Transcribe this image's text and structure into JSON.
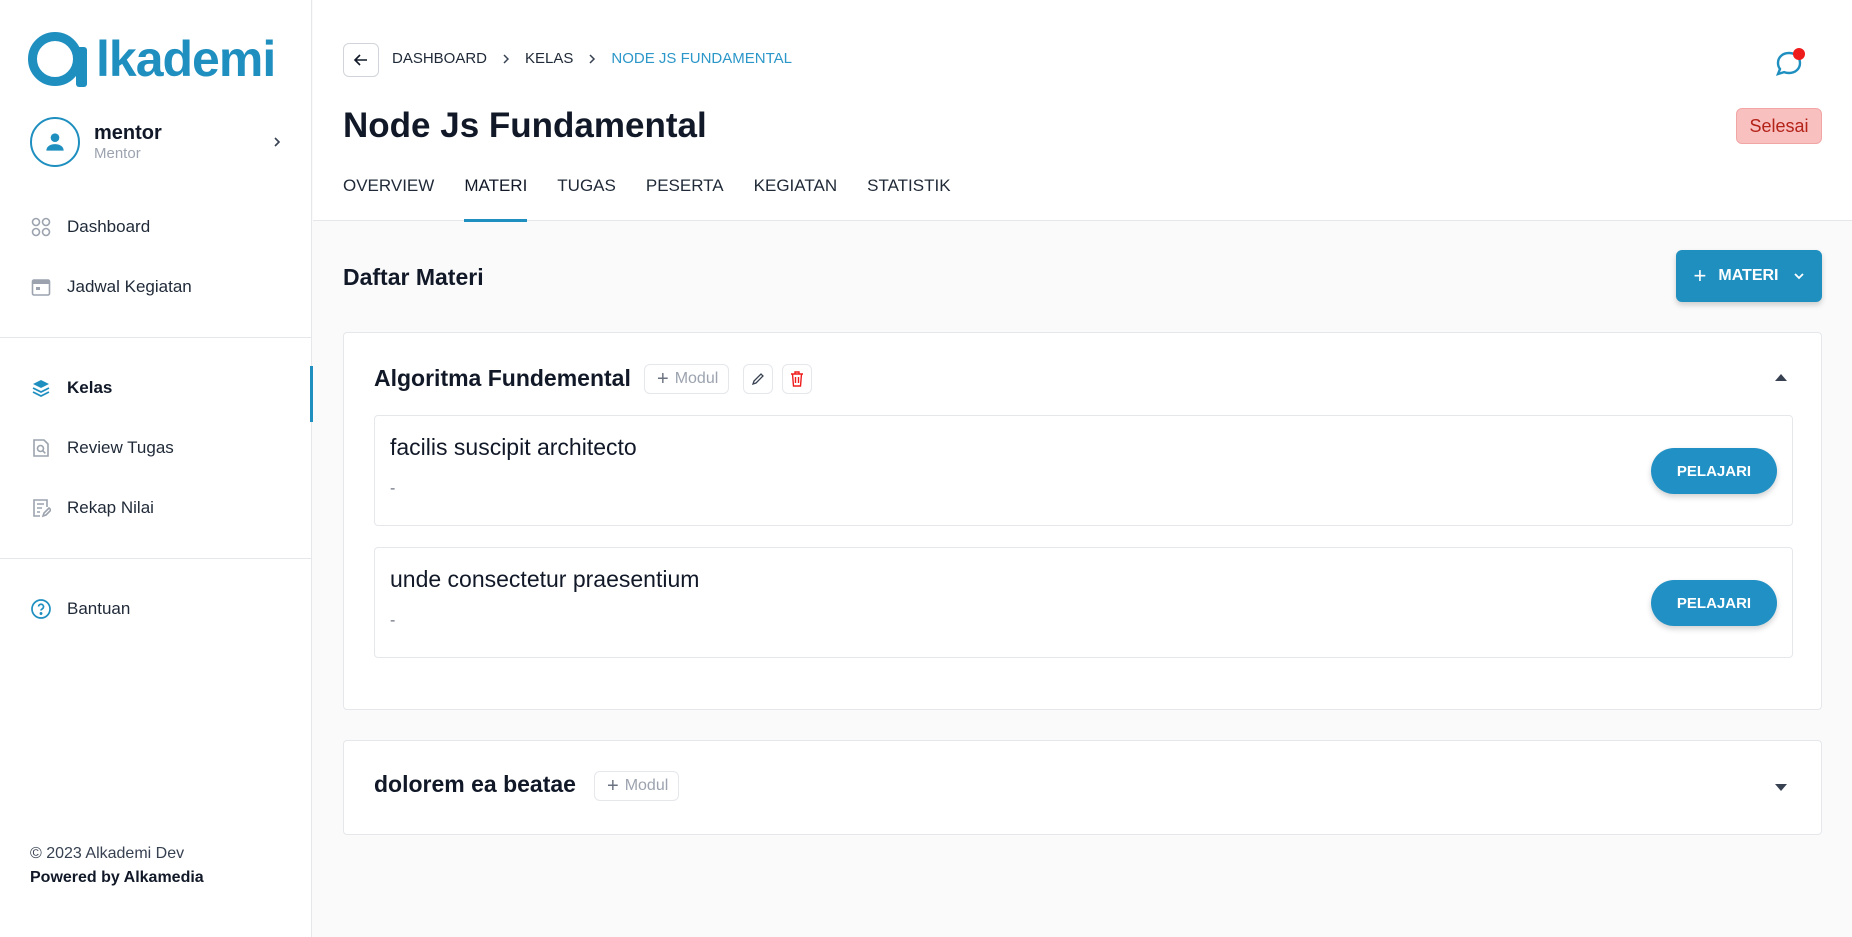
{
  "sidebar": {
    "logo_text": "lkademi",
    "profile": {
      "name": "mentor",
      "role": "Mentor"
    },
    "nav_primary": [
      {
        "label": "Dashboard",
        "icon": "grid-icon"
      },
      {
        "label": "Jadwal Kegiatan",
        "icon": "calendar-icon"
      }
    ],
    "nav_secondary": [
      {
        "label": "Kelas",
        "icon": "layers-icon",
        "active": true
      },
      {
        "label": "Review Tugas",
        "icon": "file-search-icon"
      },
      {
        "label": "Rekap Nilai",
        "icon": "edit-list-icon"
      }
    ],
    "nav_help": {
      "label": "Bantuan",
      "icon": "help-circle-icon"
    },
    "footer": {
      "copyright": "© 2023 Alkademi Dev",
      "powered": "Powered by Alkamedia"
    }
  },
  "header": {
    "breadcrumb": [
      "DASHBOARD",
      "KELAS",
      "NODE JS FUNDAMENTAL"
    ],
    "title": "Node Js Fundamental",
    "status": "Selesai",
    "tabs": [
      {
        "label": "OVERVIEW"
      },
      {
        "label": "MATERI",
        "active": true
      },
      {
        "label": "TUGAS"
      },
      {
        "label": "PESERTA"
      },
      {
        "label": "KEGIATAN"
      },
      {
        "label": "STATISTIK"
      }
    ]
  },
  "main": {
    "section_title": "Daftar Materi",
    "add_button": {
      "icon": "+",
      "label": "MATERI"
    },
    "modules": [
      {
        "title": "Algoritma Fundemental",
        "modul_button": "Modul",
        "expanded": true,
        "lessons": [
          {
            "title": "facilis suscipit architecto",
            "desc": "-",
            "action": "PELAJARI"
          },
          {
            "title": "unde consectetur praesentium",
            "desc": "-",
            "action": "PELAJARI"
          }
        ]
      },
      {
        "title": "dolorem ea beatae",
        "modul_button": "Modul",
        "expanded": false,
        "lessons": []
      }
    ]
  },
  "colors": {
    "primary": "#1f8fc0",
    "badge_bg": "#f9c0c0",
    "notification": "#ef1c1c"
  }
}
